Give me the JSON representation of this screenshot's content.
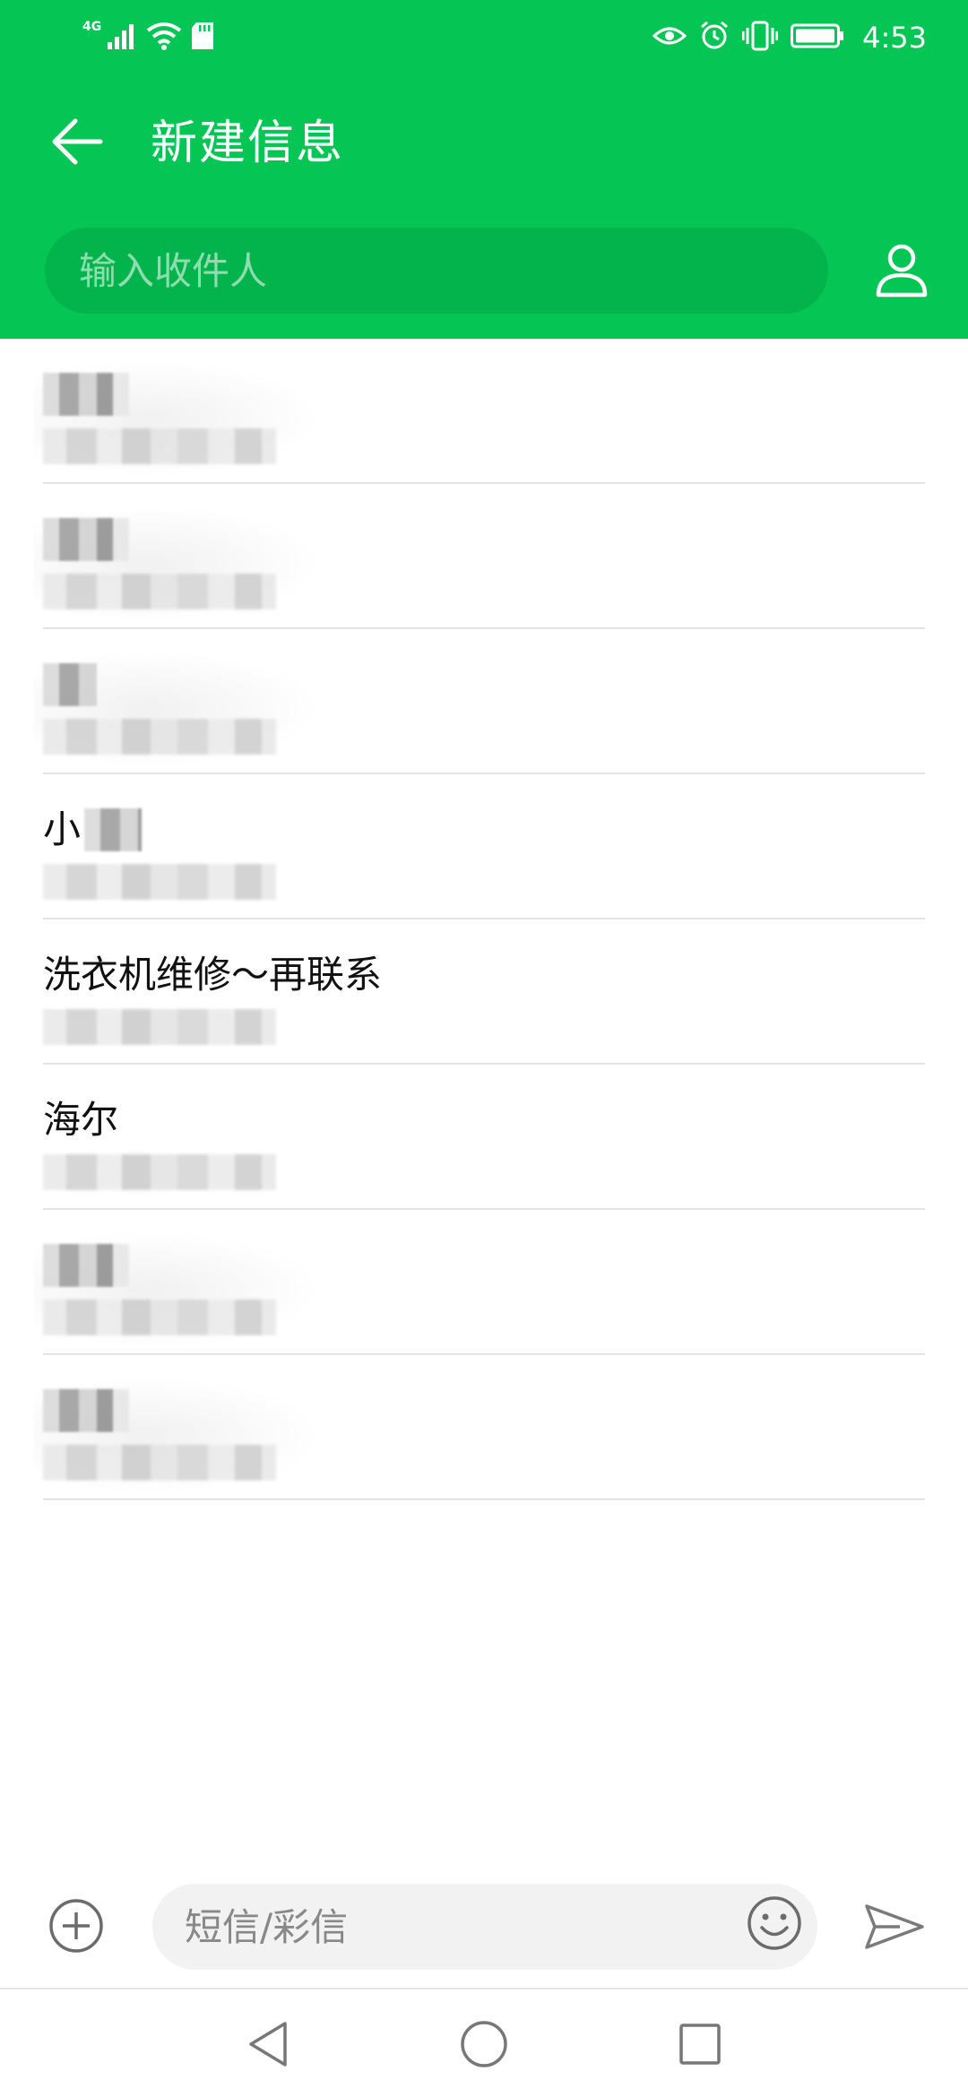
{
  "status_bar": {
    "network_type": "4G",
    "time": "4:53",
    "icons": [
      "signal-icon",
      "wifi-icon",
      "sd-card-icon",
      "eye-comfort-icon",
      "alarm-icon",
      "vibrate-icon",
      "battery-icon"
    ]
  },
  "header": {
    "title": "新建信息",
    "back_icon": "arrow-left-icon",
    "recipient_placeholder": "输入收件人",
    "contact_picker_icon": "person-icon",
    "background_color": "#05c654"
  },
  "contacts": [
    {
      "name": "",
      "number": "",
      "name_hidden": true,
      "number_hidden": true
    },
    {
      "name": "",
      "number": "",
      "name_hidden": true,
      "number_hidden": true
    },
    {
      "name": "",
      "number": "",
      "name_hidden": true,
      "number_hidden": true
    },
    {
      "name": "小",
      "number": "",
      "name_hidden": true,
      "number_hidden": true
    },
    {
      "name": "洗衣机维修～再联系",
      "number": "",
      "name_hidden": false,
      "number_hidden": true
    },
    {
      "name": "海尔",
      "number": "",
      "name_hidden": false,
      "number_hidden": true
    },
    {
      "name": "",
      "number": "",
      "name_hidden": true,
      "number_hidden": true
    },
    {
      "name": "",
      "number": "",
      "name_hidden": true,
      "number_hidden": true
    }
  ],
  "composer": {
    "add_icon": "plus-circle-icon",
    "message_placeholder": "短信/彩信",
    "emoji_icon": "smiley-icon",
    "send_icon": "send-icon"
  },
  "nav_bar": {
    "icons": [
      "triangle-back-icon",
      "circle-home-icon",
      "square-recent-icon"
    ]
  },
  "colors": {
    "accent": "#05c654",
    "divider": "#e3e3e3",
    "secondary_text": "#8a8a8a"
  }
}
